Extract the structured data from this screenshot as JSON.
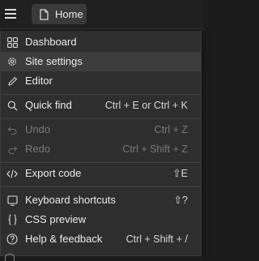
{
  "header": {
    "home_tab_label": "Home"
  },
  "menu": {
    "items": [
      {
        "label": "Dashboard",
        "shortcut": "",
        "icon": "grid-icon"
      },
      {
        "label": "Site settings",
        "shortcut": "",
        "icon": "gear-icon"
      },
      {
        "label": "Editor",
        "shortcut": "",
        "icon": "pencil-icon"
      },
      {
        "label": "Quick find",
        "shortcut": "Ctrl + E or Ctrl + K",
        "icon": "search-icon"
      },
      {
        "label": "Undo",
        "shortcut": "Ctrl + Z",
        "icon": "undo-icon"
      },
      {
        "label": "Redo",
        "shortcut": "Ctrl + Shift + Z",
        "icon": "redo-icon"
      },
      {
        "label": "Export code",
        "shortcut": "⇧E",
        "icon": "code-icon"
      },
      {
        "label": "Keyboard shortcuts",
        "shortcut": "⇧?",
        "icon": "keyboard-icon"
      },
      {
        "label": "CSS preview",
        "shortcut": "",
        "icon": "braces-icon"
      },
      {
        "label": "Help & feedback",
        "shortcut": "Ctrl + Shift + /",
        "icon": "help-icon"
      }
    ]
  },
  "colors": {
    "background": "#1c1c1c",
    "menu_bg": "#2e2e2e",
    "active_item": "#3d3d3d",
    "disabled_text": "#7a7a7a",
    "text": "#ececec"
  }
}
